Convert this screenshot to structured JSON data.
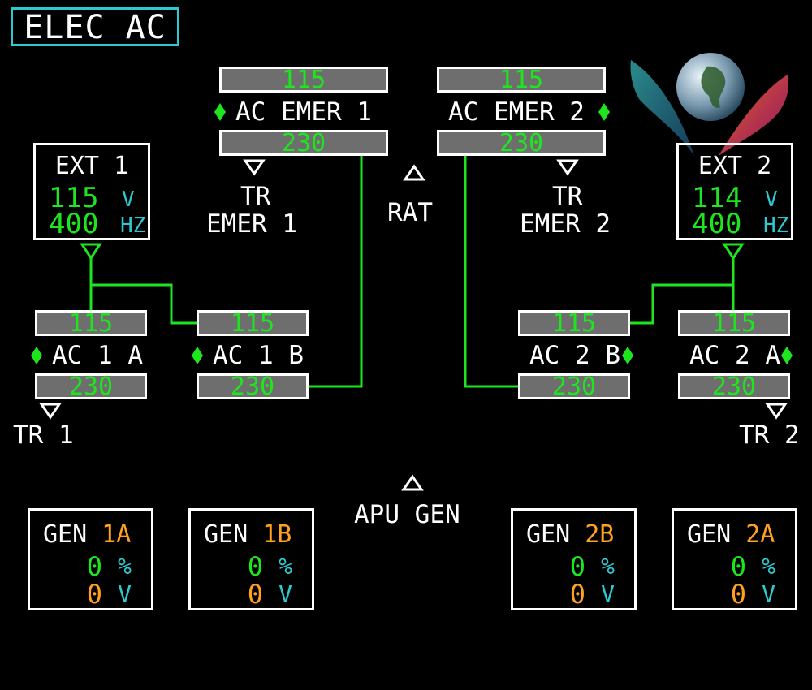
{
  "title": "ELEC AC",
  "colors": {
    "green": "#1ee61e",
    "cyan": "#2ec8d0",
    "amber": "#ffa020",
    "bar_gray": "#6e6e6e"
  },
  "ac_emer_1": {
    "upper": "115",
    "label": "AC EMER 1",
    "lower": "230"
  },
  "ac_emer_2": {
    "upper": "115",
    "label": "AC EMER 2",
    "lower": "230"
  },
  "tr_emer_1": {
    "line1": "TR",
    "line2": "EMER 1"
  },
  "tr_emer_2": {
    "line1": "TR",
    "line2": "EMER 2"
  },
  "rat": "RAT",
  "ext_1": {
    "label": "EXT 1",
    "voltage": "115",
    "voltage_unit": "V",
    "frequency": "400",
    "frequency_unit": "HZ"
  },
  "ext_2": {
    "label": "EXT 2",
    "voltage": "114",
    "voltage_unit": "V",
    "frequency": "400",
    "frequency_unit": "HZ"
  },
  "ac_1a": {
    "upper": "115",
    "label": "AC 1 A",
    "lower": "230"
  },
  "ac_1b": {
    "upper": "115",
    "label": "AC 1 B",
    "lower": "230"
  },
  "ac_2b": {
    "upper": "115",
    "label": "AC 2 B",
    "lower": "230"
  },
  "ac_2a": {
    "upper": "115",
    "label": "AC 2 A",
    "lower": "230"
  },
  "tr_1": "TR 1",
  "tr_2": "TR 2",
  "apu_gen": "APU GEN",
  "generators": [
    {
      "prefix": "GEN",
      "id": "1A",
      "load": "0",
      "load_unit": "%",
      "voltage": "0",
      "voltage_unit": "V"
    },
    {
      "prefix": "GEN",
      "id": "1B",
      "load": "0",
      "load_unit": "%",
      "voltage": "0",
      "voltage_unit": "V"
    },
    {
      "prefix": "GEN",
      "id": "2B",
      "load": "0",
      "load_unit": "%",
      "voltage": "0",
      "voltage_unit": "V"
    },
    {
      "prefix": "GEN",
      "id": "2A",
      "load": "0",
      "load_unit": "%",
      "voltage": "0",
      "voltage_unit": "V"
    }
  ]
}
